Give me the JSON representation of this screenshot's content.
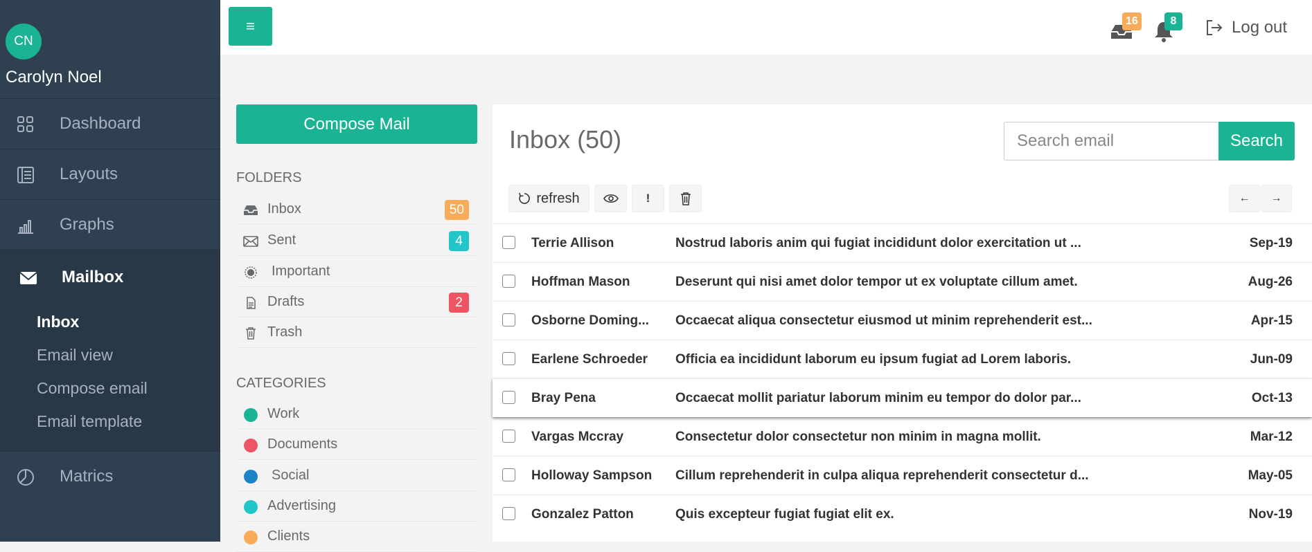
{
  "user": {
    "initials": "CN",
    "name": "Carolyn Noel"
  },
  "nav": {
    "dashboard": "Dashboard",
    "layouts": "Layouts",
    "graphs": "Graphs",
    "mailbox": "Mailbox",
    "matrics": "Matrics",
    "mailbox_sub": [
      "Inbox",
      "Email view",
      "Compose email",
      "Email template"
    ]
  },
  "topbar": {
    "menu_icon": "≡",
    "inbox_badge": "16",
    "bell_badge": "8",
    "logout": "Log out"
  },
  "compose_label": "Compose Mail",
  "folders_title": "FOLDERS",
  "folders": [
    {
      "label": "Inbox",
      "badge": "50",
      "badge_color": "#f8ac59"
    },
    {
      "label": "Sent",
      "badge": "4",
      "badge_color": "#23c6c8"
    },
    {
      "label": "Important",
      "badge": "",
      "badge_color": ""
    },
    {
      "label": "Drafts",
      "badge": "2",
      "badge_color": "#ed5565"
    },
    {
      "label": "Trash",
      "badge": "",
      "badge_color": ""
    }
  ],
  "categories_title": "CATEGORIES",
  "categories": [
    {
      "label": "Work",
      "color": "#1ab394"
    },
    {
      "label": "Documents",
      "color": "#ed5565"
    },
    {
      "label": "Social",
      "color": "#1c84c6"
    },
    {
      "label": "Advertising",
      "color": "#23c6c8"
    },
    {
      "label": "Clients",
      "color": "#f8ac59"
    }
  ],
  "inbox": {
    "title": "Inbox (50)",
    "search_placeholder": "Search email",
    "search_button": "Search",
    "refresh_label": "refresh",
    "important_glyph": "!",
    "prev_glyph": "←",
    "next_glyph": "→"
  },
  "mails": [
    {
      "sender": "Terrie Allison",
      "subject": "Nostrud laboris anim qui fugiat incididunt dolor exercitation ut ...",
      "date": "Sep-19"
    },
    {
      "sender": "Hoffman Mason",
      "subject": "Deserunt qui nisi amet dolor tempor ut ex voluptate cillum amet.",
      "date": "Aug-26"
    },
    {
      "sender": "Osborne Doming...",
      "subject": "Occaecat aliqua consectetur eiusmod ut minim reprehenderit est...",
      "date": "Apr-15"
    },
    {
      "sender": "Earlene Schroeder",
      "subject": "Officia ea incididunt laborum eu ipsum fugiat ad Lorem laboris.",
      "date": "Jun-09"
    },
    {
      "sender": "Bray Pena",
      "subject": "Occaecat mollit pariatur laborum minim eu tempor do dolor par...",
      "date": "Oct-13"
    },
    {
      "sender": "Vargas Mccray",
      "subject": "Consectetur dolor consectetur non minim in magna mollit.",
      "date": "Mar-12"
    },
    {
      "sender": "Holloway Sampson",
      "subject": "Cillum reprehenderit in culpa aliqua reprehenderit consectetur d...",
      "date": "May-05"
    },
    {
      "sender": "Gonzalez Patton",
      "subject": "Quis excepteur fugiat fugiat elit ex.",
      "date": "Nov-19"
    }
  ]
}
